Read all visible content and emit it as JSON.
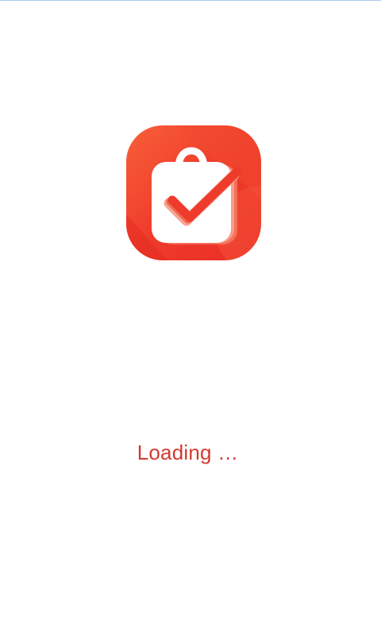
{
  "screen": {
    "background": "#ffffff",
    "top_line_color": "#a9c8ea"
  },
  "logo": {
    "icon": "shopping-bag-check-icon",
    "accent_color": "#ee3529",
    "accent_light": "#f8603a"
  },
  "loading": {
    "text": "Loading …",
    "color": "#d4392f"
  }
}
